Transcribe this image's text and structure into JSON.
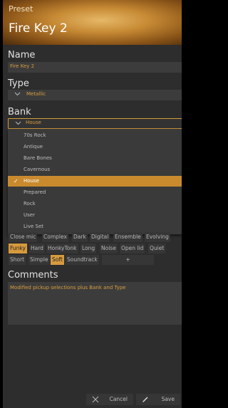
{
  "header": {
    "label": "Preset",
    "title": "Fire Key 2"
  },
  "name": {
    "label": "Name",
    "value": "Fire Key 2"
  },
  "type": {
    "label": "Type",
    "value": "Metallic"
  },
  "bank": {
    "label": "Bank",
    "value": "House",
    "options": [
      "70s Rock",
      "Antique",
      "Bare Bones",
      "Cavernous",
      "House",
      "Prepared",
      "Rock",
      "User",
      "Live Set"
    ],
    "selected_index": 4
  },
  "tags": {
    "row1": [
      "Close mic",
      "Complex",
      "Dark",
      "Digital",
      "Ensemble",
      "Evolving"
    ],
    "row2": [
      "Funky",
      "Hard",
      "HonkyTonk",
      "Long",
      "Noise",
      "Open lid",
      "Quiet"
    ],
    "row3": [
      "Short",
      "Simple",
      "Soft",
      "Soundtrack"
    ],
    "add_label": "+",
    "active": [
      "Funky",
      "Soft"
    ]
  },
  "comments": {
    "label": "Comments",
    "value": "Modified pickup selections plus Bank and Type"
  },
  "footer": {
    "cancel_label": "Cancel",
    "save_label": "Save"
  },
  "colors": {
    "accent": "#d69a3e",
    "panel": "#2d2d2d",
    "field": "#3c3c3c"
  }
}
